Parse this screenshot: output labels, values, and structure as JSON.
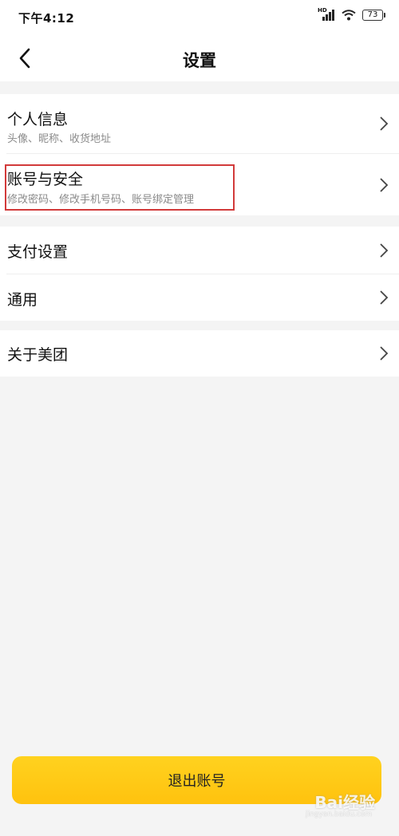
{
  "status_bar": {
    "time": "下午4:12",
    "network_label": "HD",
    "battery": "73"
  },
  "header": {
    "title": "设置",
    "back_icon": "chevron-left-icon"
  },
  "settings_groups": [
    {
      "items": [
        {
          "title": "个人信息",
          "subtitle": "头像、昵称、收货地址"
        },
        {
          "title": "账号与安全",
          "subtitle": "修改密码、修改手机号码、账号绑定管理"
        }
      ]
    },
    {
      "items": [
        {
          "title": "支付设置"
        },
        {
          "title": "通用"
        }
      ]
    },
    {
      "items": [
        {
          "title": "关于美团"
        }
      ]
    }
  ],
  "logout": {
    "label": "退出账号"
  },
  "colors": {
    "accent": "#ffc814",
    "highlight": "#d23a3a",
    "background": "#f4f4f4"
  },
  "watermark": {
    "brand": "Bai经验",
    "url": "jingyan.baidu.com"
  }
}
